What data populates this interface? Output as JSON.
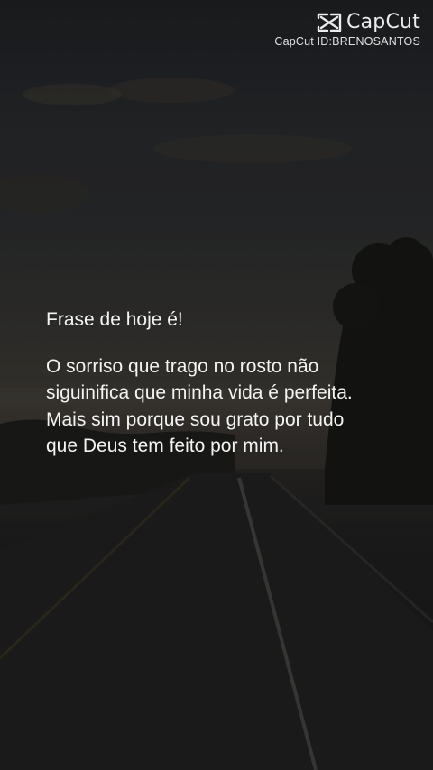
{
  "watermark": {
    "brand": "CapCut",
    "id_label": "CapCut ID:BRENOSANTOS",
    "logo_icon": "capcut-logo-icon"
  },
  "quote": {
    "heading": "Frase de hoje é!",
    "lines": [
      "O sorriso que trago no rosto não",
      "siguinifica que minha vida é perfeita.",
      "Mais sim porque sou grato por tudo",
      "que Deus tem feito por mim."
    ]
  },
  "colors": {
    "text": "#f4f4f4",
    "sky_dark": "#1d1f22",
    "horizon": "#3b3833",
    "road": "#1e1e1e"
  }
}
